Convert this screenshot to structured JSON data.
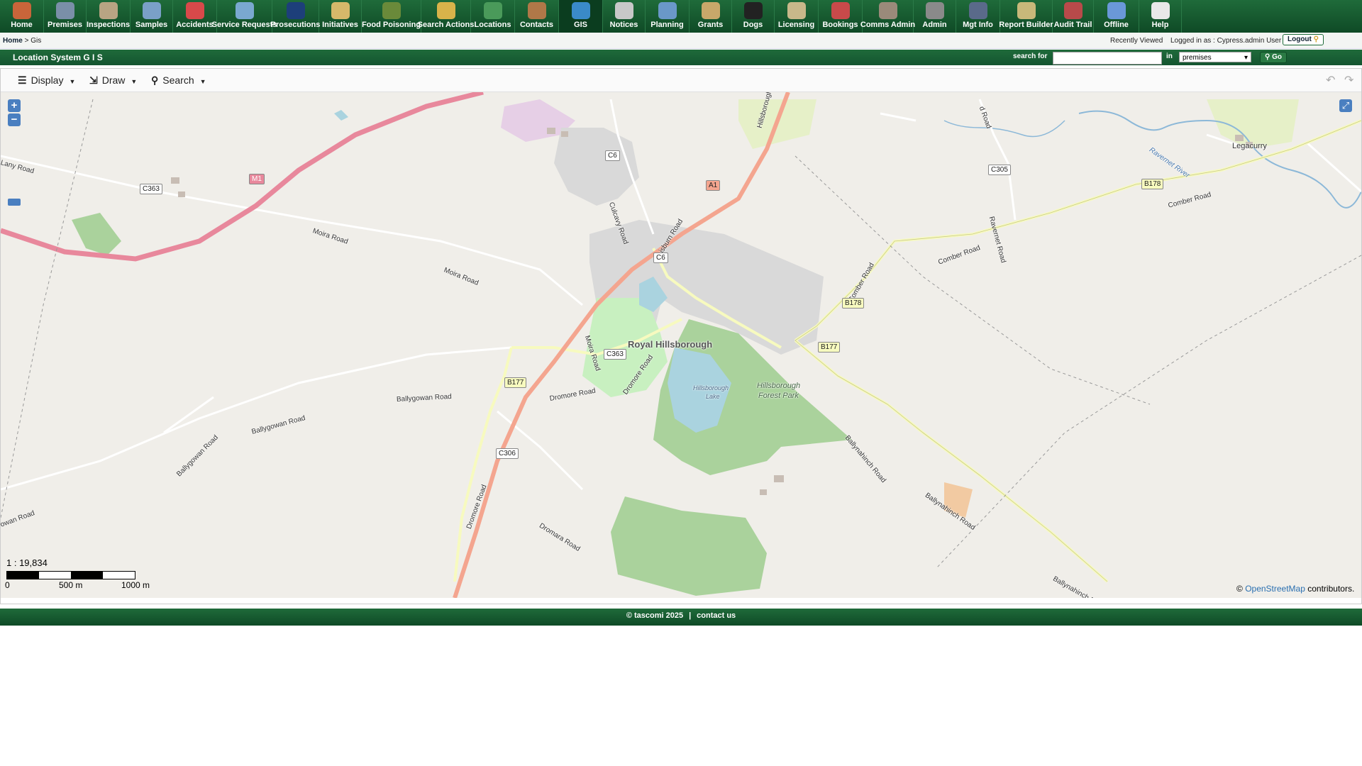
{
  "nav": {
    "items": [
      {
        "label": "Home",
        "icon": "home-icon",
        "color": "#c9653a"
      },
      {
        "label": "Premises",
        "icon": "building-icon",
        "color": "#7a8fa8"
      },
      {
        "label": "Inspections",
        "icon": "clipboard-icon",
        "color": "#b8a483"
      },
      {
        "label": "Samples",
        "icon": "flask-icon",
        "color": "#7aa0c8"
      },
      {
        "label": "Accidents",
        "icon": "first-aid-icon",
        "color": "#d8494a"
      },
      {
        "label": "Service Requests",
        "icon": "document-icon",
        "color": "#7aa8d0"
      },
      {
        "label": "Prosecutions",
        "icon": "gavel-icon",
        "color": "#1d3f7a"
      },
      {
        "label": "Initiatives",
        "icon": "envelope-icon",
        "color": "#d6b86a"
      },
      {
        "label": "Food Poisoning",
        "icon": "bug-icon",
        "color": "#6a8a3a"
      },
      {
        "label": "Search Actions",
        "icon": "folder-icon",
        "color": "#d8b34a"
      },
      {
        "label": "Locations",
        "icon": "globe-icon",
        "color": "#4a9a5a"
      },
      {
        "label": "Contacts",
        "icon": "person-icon",
        "color": "#b07848"
      },
      {
        "label": "GIS",
        "icon": "map-globe-icon",
        "color": "#3a8ac8"
      },
      {
        "label": "Notices",
        "icon": "notice-icon",
        "color": "#c8c8c8"
      },
      {
        "label": "Planning",
        "icon": "blueprint-icon",
        "color": "#6a98c8"
      },
      {
        "label": "Grants",
        "icon": "pen-paper-icon",
        "color": "#c8a86a"
      },
      {
        "label": "Dogs",
        "icon": "paw-icon",
        "color": "#222222"
      },
      {
        "label": "Licensing",
        "icon": "certificate-icon",
        "color": "#c8b88a"
      },
      {
        "label": "Bookings",
        "icon": "calendar-icon",
        "color": "#c84a4a"
      },
      {
        "label": "Comms Admin",
        "icon": "tools-icon",
        "color": "#9a8a7a"
      },
      {
        "label": "Admin",
        "icon": "wrench-icon",
        "color": "#8a8a8a"
      },
      {
        "label": "Mgt Info",
        "icon": "manager-icon",
        "color": "#5a6a8a"
      },
      {
        "label": "Report Builder",
        "icon": "report-icon",
        "color": "#c8b87a"
      },
      {
        "label": "Audit Trail",
        "icon": "books-icon",
        "color": "#b84a4a"
      },
      {
        "label": "Offline",
        "icon": "offline-folder-icon",
        "color": "#6a98d8"
      },
      {
        "label": "Help",
        "icon": "help-icon",
        "color": "#e8e8e8"
      }
    ],
    "active": "GIS"
  },
  "breadcrumb": {
    "home": "Home",
    "sep": ">",
    "current": "Gis"
  },
  "header": {
    "recently_viewed": "Recently Viewed",
    "logged_in": "Logged in as : Cypress.admin User",
    "logout": "Logout"
  },
  "titlebar": {
    "title": "Location System G I S",
    "search_label": "search for",
    "search_value": "",
    "in_label": "in",
    "in_value": "premises",
    "go_label": "Go"
  },
  "toolbar": {
    "display": "Display",
    "draw": "Draw",
    "search": "Search"
  },
  "map": {
    "labels": {
      "town": "Royal Hillsborough",
      "forest": "Hillsborough",
      "forest2": "Forest Park",
      "lake": "Hillsborough",
      "lake2": "Lake",
      "legacurry": "Legacurry",
      "ravernet": "Ravernet River",
      "moira1": "Moira Road",
      "moira2": "Moira Road",
      "moira3": "Moira Road",
      "ballygowan1": "Ballygowan Road",
      "ballygowan2": "Ballygowan Road",
      "ballygowan3": "Ballygowan Road",
      "dromore1": "Dromore Road",
      "dromore2": "Dromore Road",
      "dromore3": "Dromore Road",
      "dromara": "Dromara Road",
      "lisburn": "Lisburn Road",
      "culcavy": "Culcavy Road",
      "hillsborough_rd": "Hillsborough Road",
      "comber1": "Comber Road",
      "comber2": "Comber Road",
      "comber3": "Comber Road",
      "ballynahinch1": "Ballynahinch Road",
      "ballynahinch2": "Ballynahinch Road",
      "ballynahinch3": "Ballynahinch Roa",
      "ravernet_rd": "Ravernet Road",
      "lany": "Lany Road",
      "b_road": "d Road",
      "wan": "owan Road"
    },
    "shields": {
      "m1": "M1",
      "a1": "A1",
      "c363a": "C363",
      "c363b": "C363",
      "c6a": "C6",
      "c6b": "C6",
      "b178a": "B178",
      "b178b": "B178",
      "b177a": "B177",
      "b177b": "B177",
      "c305": "C305",
      "c306": "C306"
    },
    "scale": "1 : 19,834",
    "scale_ticks": {
      "t0": "0",
      "t1": "500 m",
      "t2": "1000 m"
    },
    "attribution_prefix": "©",
    "attribution_link": "OpenStreetMap",
    "attribution_suffix": "contributors."
  },
  "footer": {
    "copyright": "© tascomi 2025",
    "sep": "|",
    "contact": "contact us"
  }
}
